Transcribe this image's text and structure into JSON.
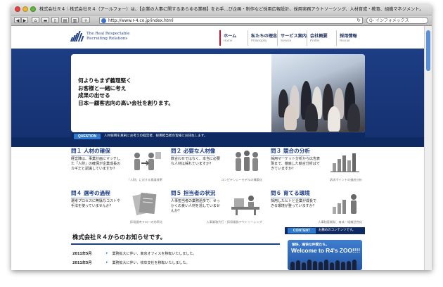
{
  "window": {
    "title": "株式会社Ｒ４｜株式会社Ｒ４（アールフォー）は、【企業の人事に関するあらゆる業務】をお手…び企画・制作など採用広報設計、採用実務アウトソーシング、人材育成・教育、組織マネジメント。"
  },
  "toolbar": {
    "back": "◀",
    "forward": "▶",
    "plus": "+",
    "url": "http://www.r-4.co.jp/index.html",
    "search_placeholder": "Q- インフォメックス"
  },
  "header": {
    "logo_line1": "The Real Respectable",
    "logo_line2": "Recruiting Relations",
    "nav": [
      {
        "jp": "ホーム",
        "en": "Home"
      },
      {
        "jp": "私たちの理念",
        "en": "Philosophy"
      },
      {
        "jp": "サービス案内",
        "en": "Service"
      },
      {
        "jp": "会社概要",
        "en": "Profile"
      },
      {
        "jp": "採用情報",
        "en": "Recruit"
      }
    ]
  },
  "hero": {
    "lines": [
      "何よりもまず義理堅く",
      "お客様と一緒に考え",
      "成果の出せる",
      "日本一顧客志向の高い会社を創ります。"
    ]
  },
  "question_bar": {
    "tag": "QUESTION",
    "text": "人材採用を真剣にお考えの経営者、採用担当者の皆様にお訊ねします。"
  },
  "questions": [
    {
      "title": "問１ 人材の確保",
      "desc": "経営陣は、事業計画にマッチした「人財」の確保が企業成長のカギだと認識していますか？",
      "caption": "「人財」に対する意識改革",
      "icon": "people-arrows-icon"
    },
    {
      "title": "問２ 必要な人材像",
      "desc": "数合わせではなく、本当に必要な人材は採れていますか？",
      "caption": "コンピテンシーモデルの構築化",
      "icon": "team-figures-icon"
    },
    {
      "title": "問３ 競合の分析",
      "desc": "採用マーケット分析から広告表現まで、徹底した競合分析はできていますか？",
      "caption": "訴求ポイントの徹底分析",
      "icon": "bar-chart-icon"
    },
    {
      "title": "問４ 選考の過程",
      "desc": "選考プロセスに無駄なコストや手法を使っていませんか？",
      "caption": "採用選考フローの効率化",
      "icon": "documents-icon"
    },
    {
      "title": "問５ 担当者の状況",
      "desc": "人事担当者の業務過多で、せっかくの良い人材を逃していませんか？",
      "caption": "人事業務代行・採用業務アウトソーシング",
      "icon": "busy-desk-icon"
    },
    {
      "title": "問６ 育てる環境",
      "desc": "採用したヒトと企業が成長できる環境が整っていますか？",
      "caption": "人事制度開発、育成・組織活性化",
      "icon": "growth-chart-icon"
    }
  ],
  "news": {
    "title": "株式会社Ｒ４からのお知らせです。",
    "items": [
      {
        "date": "2011年5月",
        "text": "業務拡大に伴い、東京オフィスを移転いたしました。"
      },
      {
        "date": "2011年5月",
        "text": "業務拡大に伴い、岐阜支社を移転いたしました。"
      }
    ]
  },
  "content_block": {
    "tag": "CONTENT",
    "text": "お薦めのコンテンツです。",
    "banner_sub": "愉快、痛快な仲間たち。",
    "banner_main": "Welcome to R4's ZOO!!!!"
  }
}
